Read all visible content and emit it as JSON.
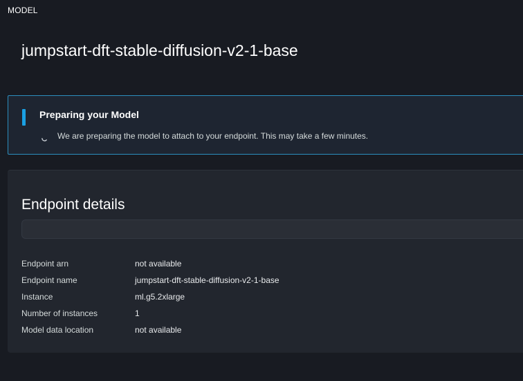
{
  "header": {
    "section_label": "MODEL",
    "model_name": "jumpstart-dft-stable-diffusion-v2-1-base"
  },
  "alert": {
    "title": "Preparing your Model",
    "message": "We are preparing the model to attach to your endpoint. This may take a few minutes.",
    "accent_color": "#1aa0e3",
    "icon": "spinner-icon"
  },
  "endpoint": {
    "title": "Endpoint details",
    "rows": [
      {
        "key": "Endpoint arn",
        "value": "not available"
      },
      {
        "key": "Endpoint name",
        "value": "jumpstart-dft-stable-diffusion-v2-1-base"
      },
      {
        "key": "Instance",
        "value": "ml.g5.2xlarge"
      },
      {
        "key": "Number of instances",
        "value": "1"
      },
      {
        "key": "Model data location",
        "value": "not available"
      }
    ]
  }
}
